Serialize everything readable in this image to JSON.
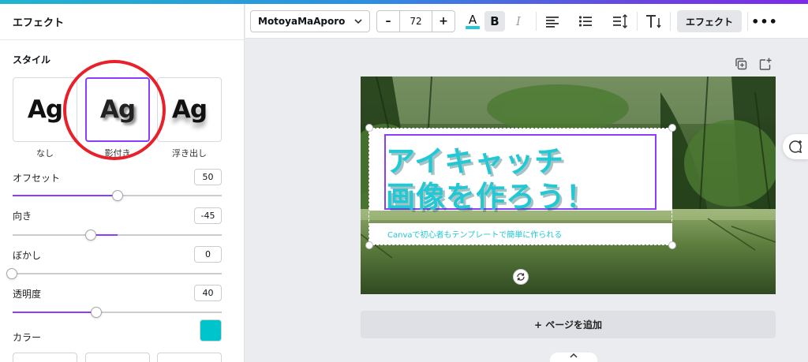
{
  "panel": {
    "title": "エフェクト",
    "section_title": "スタイル",
    "styles": [
      {
        "sample": "Ag",
        "label": "なし",
        "selected": false
      },
      {
        "sample": "Ag",
        "label": "影付き",
        "selected": true
      },
      {
        "sample": "Ag",
        "label": "浮き出し",
        "selected": false
      }
    ],
    "properties": [
      {
        "label": "オフセット",
        "value": "50",
        "fill": 0.5
      },
      {
        "label": "向き",
        "value": "-45",
        "fill": 0.375
      },
      {
        "label": "ぼかし",
        "value": "0",
        "fill": 0.0
      },
      {
        "label": "透明度",
        "value": "40",
        "fill": 0.4
      }
    ],
    "color_label": "カラー",
    "shadow_color": "#00C4CC",
    "accent_color": "#8B3DFF"
  },
  "toolbar": {
    "font_name": "MotoyaMaAporo",
    "font_size": "72",
    "minus": "–",
    "plus": "+",
    "text_color_glyph": "A",
    "bold_glyph": "B",
    "italic_glyph": "I",
    "effects_label": "エフェクト",
    "more": "•••"
  },
  "canvas": {
    "title_line1": "アイキャッチ",
    "title_line2": "画像を作ろう！",
    "subtitle": "Canvaで初心者もテンプレートで簡単に作られる",
    "title_color": "#22C8D3",
    "add_page_label": "+ ページを追加"
  },
  "icons": [
    "chevron-down-icon",
    "text-color-icon",
    "bold-icon",
    "italic-icon",
    "align-left-icon",
    "list-icon",
    "line-spacing-icon",
    "text-size-icon",
    "copy-page-icon",
    "add-page-icon",
    "rotate-icon",
    "comment-add-icon",
    "chevron-up-icon"
  ]
}
